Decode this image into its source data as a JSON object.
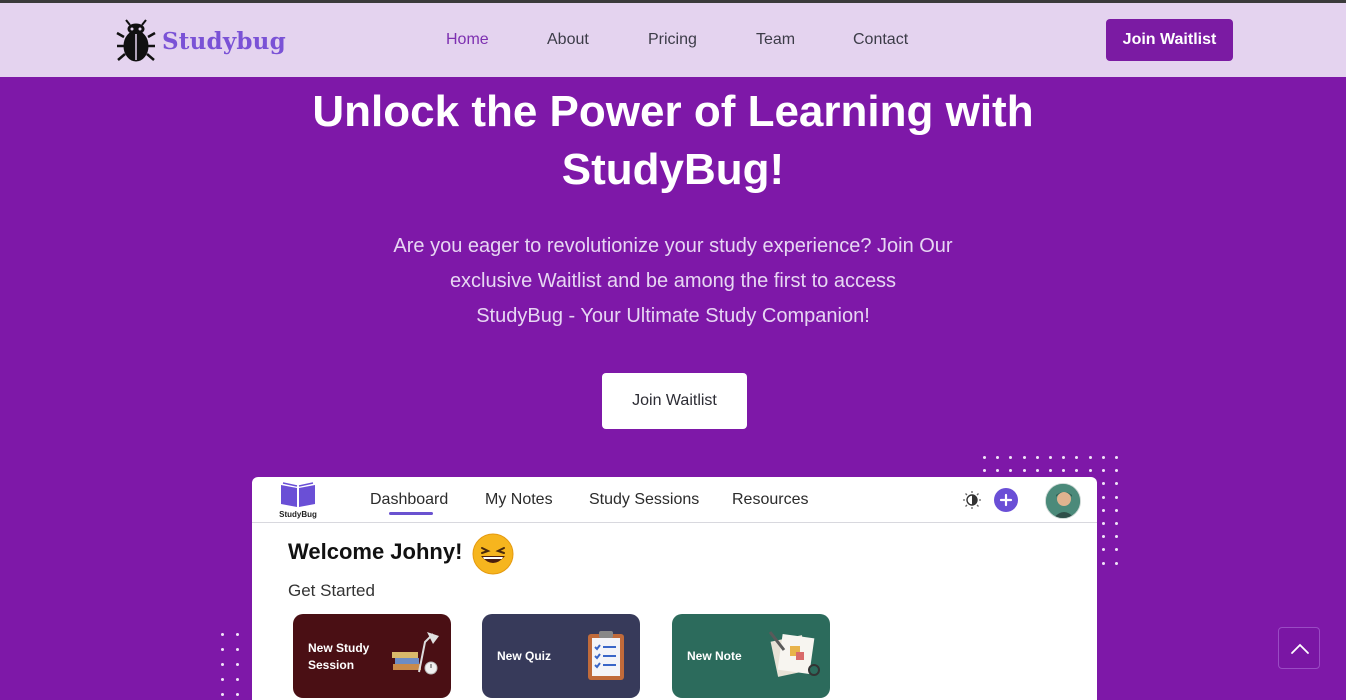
{
  "header": {
    "brand": "Studybug",
    "nav": [
      {
        "label": "Home",
        "active": true
      },
      {
        "label": "About",
        "active": false
      },
      {
        "label": "Pricing",
        "active": false
      },
      {
        "label": "Team",
        "active": false
      },
      {
        "label": "Contact",
        "active": false
      }
    ],
    "cta_label": "Join Waitlist"
  },
  "hero": {
    "title_line1": "Unlock the Power of Learning with",
    "title_line2": "StudyBug!",
    "subtitle_line1": "Are you eager to revolutionize your study experience? Join Our",
    "subtitle_line2": "exclusive Waitlist and be among the first to access",
    "subtitle_line3": "StudyBug - Your Ultimate Study Companion!",
    "button_label": "Join Waitlist"
  },
  "preview": {
    "app_logo_text": "StudyBug",
    "tabs": [
      {
        "label": "Dashboard",
        "active": true
      },
      {
        "label": "My Notes",
        "active": false
      },
      {
        "label": "Study Sessions",
        "active": false
      },
      {
        "label": "Resources",
        "active": false
      }
    ],
    "welcome": "Welcome Johny!",
    "get_started": "Get Started",
    "cards": [
      {
        "line1": "New Study",
        "line2": "Session",
        "color": "#4a0f14",
        "icon": "desk-lamp-books-icon"
      },
      {
        "line1": "New Quiz",
        "line2": "",
        "color": "#373a5a",
        "icon": "quiz-clipboard-icon"
      },
      {
        "line1": "New Note",
        "line2": "",
        "color": "#2c6b5c",
        "icon": "notes-pencil-icon"
      }
    ]
  },
  "colors": {
    "page_bg": "#7e18a8",
    "header_bg": "#e4d3ef",
    "brand_purple": "#7a52d6",
    "button_purple": "#7b1ba3"
  }
}
